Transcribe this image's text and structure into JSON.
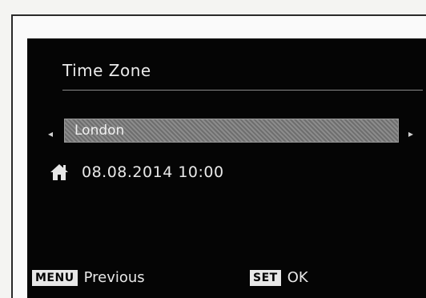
{
  "menu": {
    "title": "Time Zone",
    "zone_value": "London",
    "left_arrow_icon": "left-arrow-icon",
    "right_arrow_icon": "right-arrow-icon",
    "home_icon": "home-icon",
    "datetime": "08.08.2014 10:00"
  },
  "footer": {
    "menu_key": "MENU",
    "menu_label": "Previous",
    "set_key": "SET",
    "set_label": "OK"
  }
}
